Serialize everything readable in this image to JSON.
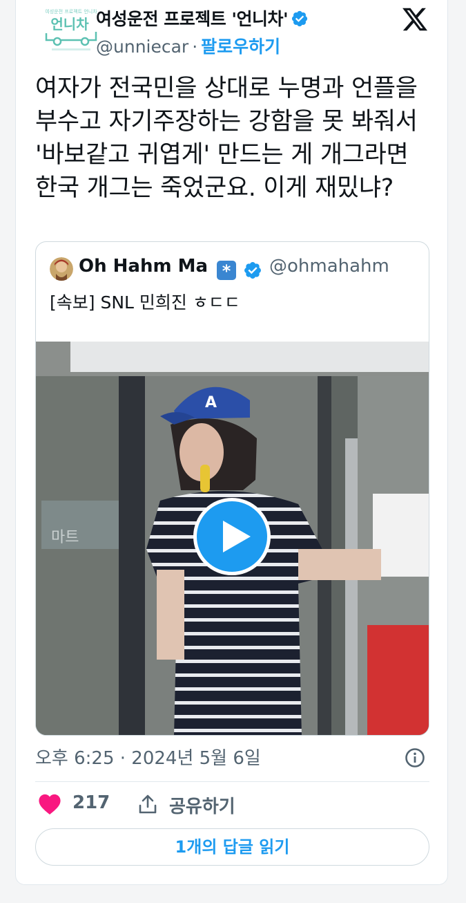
{
  "author": {
    "display_name": "여성운전 프로젝트 '언니차'",
    "handle": "@unniecar",
    "separator": "·",
    "follow_label": "팔로우하기",
    "avatar_label": "언니차",
    "avatar_caption": "여성운전 프로젝트 언니차"
  },
  "tweet": {
    "text": "여자가 전국민을 상대로 누명과 언플을 부수고 자기주장하는 강함을 못 봐줘서 '바보같고 귀엽게' 만드는 게 개그라면 한국 개그는 죽었군요. 이게 재밌냐?"
  },
  "quote": {
    "name": "Oh Hahm Ma",
    "badge_symbol": "*",
    "handle": "@ohmahahm",
    "text": "[속보] SNL 민희진 ㅎㄷㄷ",
    "media_sign": "마트"
  },
  "meta": {
    "timestamp": "오후 6:25 · 2024년 5월 6일"
  },
  "actions": {
    "like_count": "217",
    "share_label": "공유하기",
    "reply_label": "1개의 답글 읽기"
  },
  "colors": {
    "accent": "#1d9bf0",
    "like": "#f91880",
    "secondary_text": "#536471"
  }
}
